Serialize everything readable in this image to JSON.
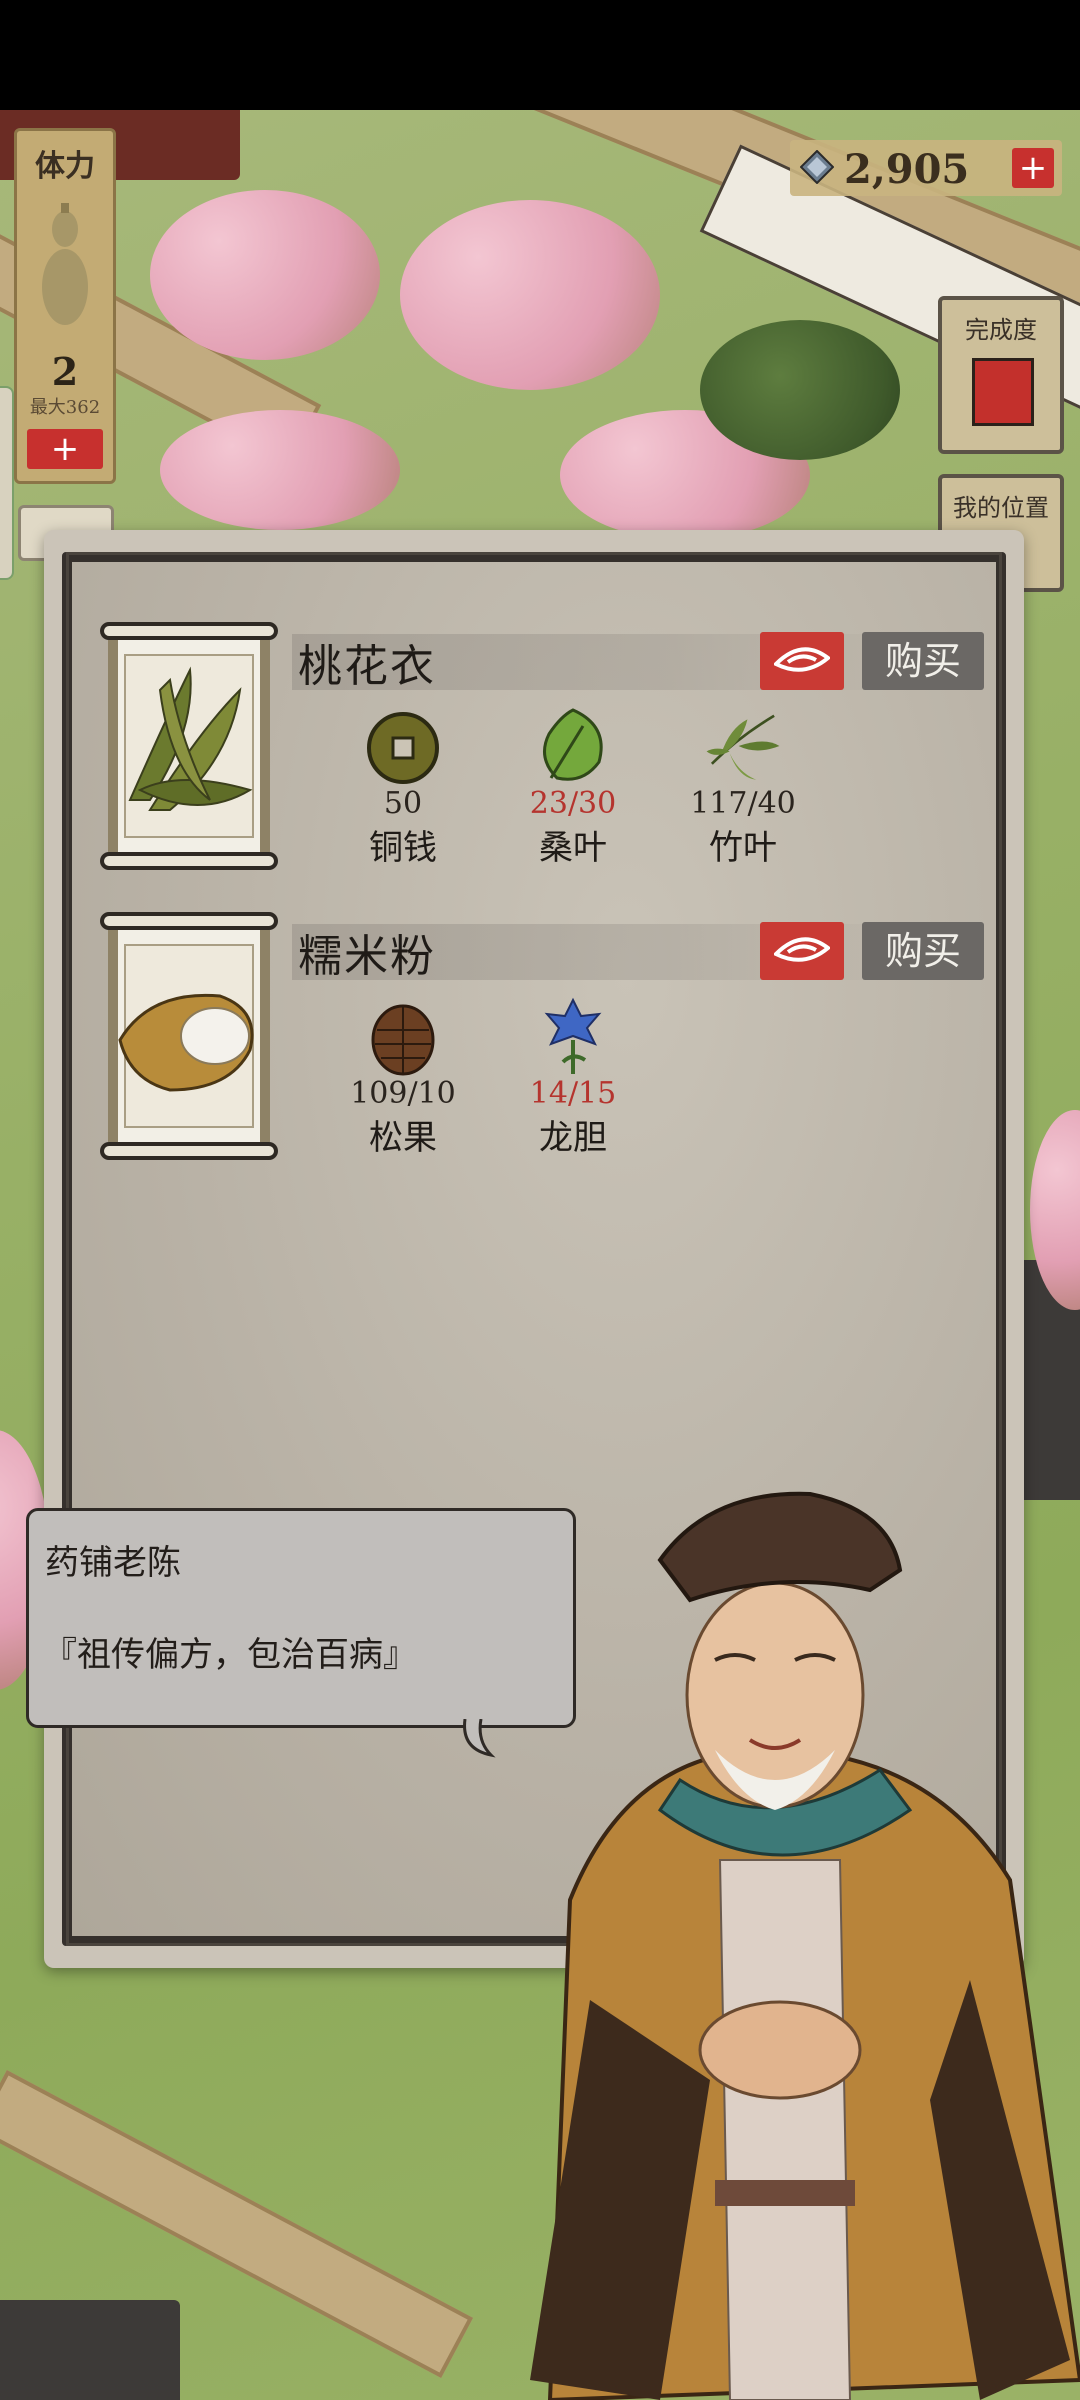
{
  "hud": {
    "stamina_label": "体力",
    "stamina_value": "2",
    "stamina_max": "最大362",
    "stamina_add": "+",
    "currency_value": "2,905",
    "currency_add": "+",
    "completion_label": "完成度",
    "location_label": "我的位置"
  },
  "shop": {
    "items": [
      {
        "name": "桃花衣",
        "buy_label": "购买",
        "icon": "bamboo-leaves-bundle-icon",
        "materials": [
          {
            "count": "50",
            "name": "铜钱",
            "icon": "copper-coin-icon",
            "insufficient": false
          },
          {
            "count": "23/30",
            "name": "桑叶",
            "icon": "mulberry-leaf-icon",
            "insufficient": true
          },
          {
            "count": "117/40",
            "name": "竹叶",
            "icon": "bamboo-leaf-icon",
            "insufficient": false
          }
        ]
      },
      {
        "name": "糯米粉",
        "buy_label": "购买",
        "icon": "rice-flour-sack-icon",
        "materials": [
          {
            "count": "109/10",
            "name": "松果",
            "icon": "pine-cone-icon",
            "insufficient": false
          },
          {
            "count": "14/15",
            "name": "龙胆",
            "icon": "gentian-flower-icon",
            "insufficient": true
          }
        ]
      }
    ]
  },
  "dialog": {
    "speaker": "药铺老陈",
    "text": "『祖传偏方，包治百病』"
  },
  "colors": {
    "button_red": "#c93a34",
    "buy_gray": "#6b6865",
    "insufficient_red": "#b5342e"
  }
}
